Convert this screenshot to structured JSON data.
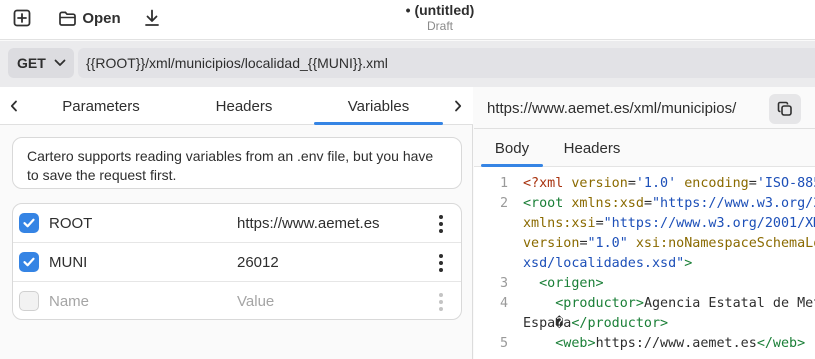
{
  "header": {
    "open_label": "Open",
    "title": "• (untitled)",
    "subtitle": "Draft"
  },
  "request": {
    "method": "GET",
    "url": "{{ROOT}}/xml/municipios/localidad_{{MUNI}}.xml"
  },
  "left_tabs": [
    "Parameters",
    "Headers",
    "Variables"
  ],
  "active_left_tab": "Variables",
  "banner_text": "Cartero supports reading variables from an .env file, but you have to save the request first.",
  "variables": [
    {
      "name": "ROOT",
      "value": "https://www.aemet.es",
      "checked": true
    },
    {
      "name": "MUNI",
      "value": "26012",
      "checked": true
    }
  ],
  "new_variable": {
    "name_placeholder": "Name",
    "value_placeholder": "Value"
  },
  "response": {
    "url": "https://www.aemet.es/xml/municipios/",
    "tabs": [
      "Body",
      "Headers"
    ],
    "active_tab": "Body",
    "line_numbers": [
      "1",
      "2",
      "",
      "",
      "3",
      "4",
      "",
      "5"
    ]
  },
  "colors": {
    "accent": "#3584e4"
  }
}
